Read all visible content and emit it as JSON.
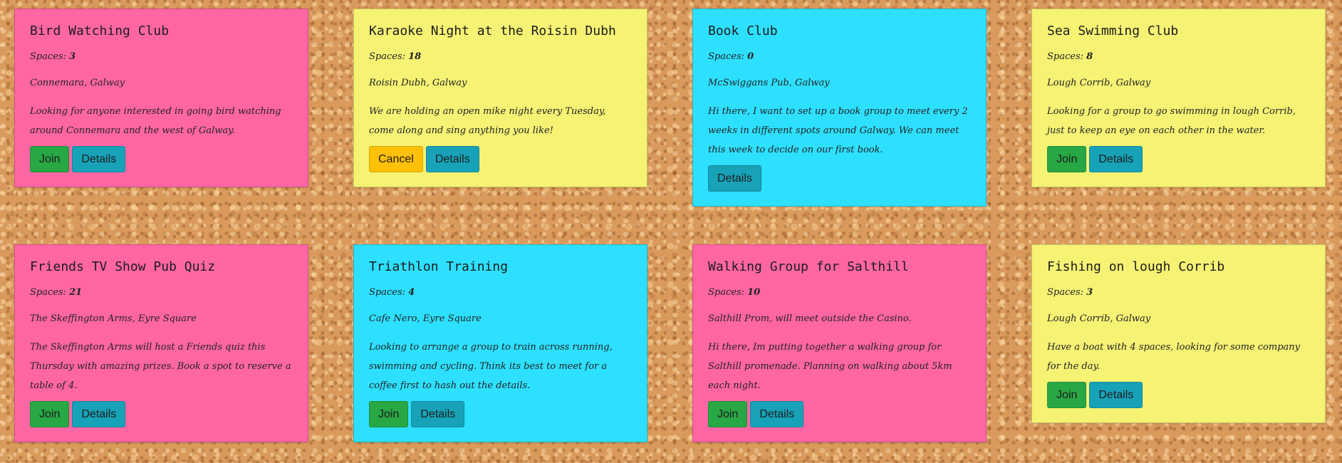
{
  "labels": {
    "spaces": "Spaces: ",
    "join": "Join",
    "details": "Details",
    "cancel": "Cancel"
  },
  "cards": [
    {
      "title": "Bird Watching Club",
      "spaces": "3",
      "location": "Connemara, Galway",
      "description": "Looking for anyone interested in going bird watching around Connemara and the west of Galway.",
      "color": "#ff66a3"
    },
    {
      "title": "Karaoke Night at the Roisin Dubh",
      "spaces": "18",
      "location": "Roisin Dubh, Galway",
      "description": "We are holding an open mike night every Tuesday, come along and sing anything you like!",
      "color": "#f5f274"
    },
    {
      "title": "Book Club",
      "spaces": "0",
      "location": "McSwiggans Pub, Galway",
      "description": "Hi there, I want to set up a book group to meet every 2 weeks in different spots around Galway. We can meet this week to decide on our first book.",
      "color": "#2ee0ff"
    },
    {
      "title": "Sea Swimming Club",
      "spaces": "8",
      "location": "Lough Corrib, Galway",
      "description": "Looking for a group to go swimming in lough Corrib, just to keep an eye on each other in the water.",
      "color": "#f5f274"
    },
    {
      "title": "Friends TV Show Pub Quiz",
      "spaces": "21",
      "location": "The Skeffington Arms, Eyre Square",
      "description": "The Skeffington Arms will host a Friends quiz this Thursday with amazing prizes. Book a spot to reserve a table of 4.",
      "color": "#ff66a3"
    },
    {
      "title": "Triathlon Training",
      "spaces": "4",
      "location": "Cafe Nero, Eyre Square",
      "description": "Looking to arrange a group to train across running, swimming and cycling. Think its best to meet for a coffee first to hash out the details.",
      "color": "#2ee0ff"
    },
    {
      "title": "Walking Group for Salthill",
      "spaces": "10",
      "location": "Salthill Prom, will meet outside the Casino.",
      "description": "Hi there, Im putting together a walking group for Salthill promenade. Planning on walking about 5km each night.",
      "color": "#ff66a3"
    },
    {
      "title": "Fishing on lough Corrib",
      "spaces": "3",
      "location": "Lough Corrib, Galway",
      "description": "Have a boat with 4 spaces, looking for some company for the day.",
      "color": "#f5f274"
    }
  ]
}
